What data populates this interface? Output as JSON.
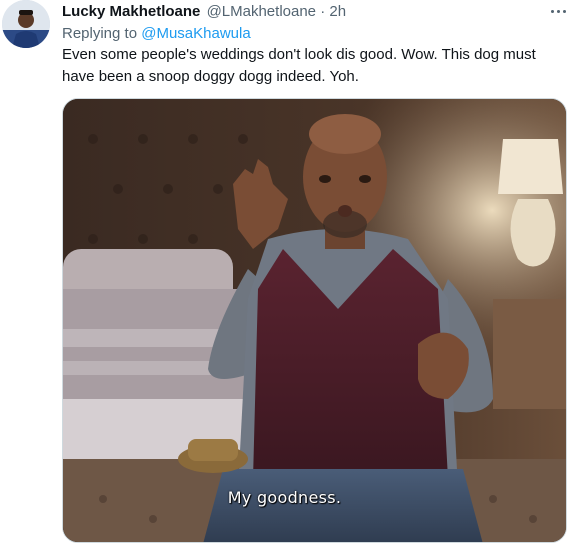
{
  "author": {
    "name": "Lucky Makhetloane",
    "handle": "@LMakhetloane",
    "separator": "·",
    "time": "2h"
  },
  "reply": {
    "prefix": "Replying to",
    "to_handle": "@MusaKhawula"
  },
  "tweet": {
    "text": "Even some people's weddings don't look dis good. Wow. This dog must have been a snoop doggy dogg indeed. Yoh."
  },
  "media": {
    "caption": "My goodness."
  },
  "colors": {
    "link": "#1d9bf0",
    "secondary_text": "#536471",
    "primary_text": "#0f1419"
  },
  "icons": {
    "more": "more-horizontal-icon"
  }
}
